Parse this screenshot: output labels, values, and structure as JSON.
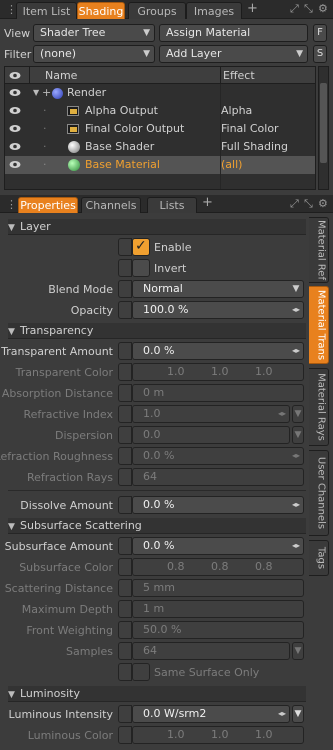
{
  "top_tabs": [
    "Item List",
    "Shading",
    "Groups",
    "Images"
  ],
  "top_active_tab": 1,
  "view": {
    "label": "View",
    "value": "Shader Tree",
    "assign": "Assign Material",
    "f_btn": "F"
  },
  "filter": {
    "label": "Filter",
    "value": "(none)",
    "add_layer": "Add Layer",
    "s_btn": "S"
  },
  "tree": {
    "col_name": "Name",
    "col_effect": "Effect",
    "rows": [
      {
        "name": "Render",
        "effect": ""
      },
      {
        "name": "Alpha Output",
        "effect": "Alpha"
      },
      {
        "name": "Final Color Output",
        "effect": "Final Color"
      },
      {
        "name": "Base Shader",
        "effect": "Full Shading"
      },
      {
        "name": "Base Material",
        "effect": "(all)"
      }
    ]
  },
  "prop_tabs": [
    "Properties",
    "Channels",
    "Lists"
  ],
  "side_tabs": [
    "Material Ref",
    "Material Trans",
    "Material Rays",
    "User Channels",
    "Tags"
  ],
  "sections": {
    "layer": "Layer",
    "transparency": "Transparency",
    "subsurface": "Subsurface Scattering",
    "luminosity": "Luminosity"
  },
  "layer": {
    "enable": "Enable",
    "invert": "Invert",
    "blend_label": "Blend Mode",
    "blend_value": "Normal",
    "opacity_label": "Opacity",
    "opacity_value": "100.0 %"
  },
  "transparency": {
    "amount_label": "Transparent Amount",
    "amount_value": "0.0 %",
    "color_label": "Transparent Color",
    "color_r": "1.0",
    "color_g": "1.0",
    "color_b": "1.0",
    "absorption_label": "Absorption Distance",
    "absorption_value": "0 m",
    "refr_index_label": "Refractive Index",
    "refr_index_value": "1.0",
    "dispersion_label": "Dispersion",
    "dispersion_value": "0.0",
    "refr_rough_label": "Refraction Roughness",
    "refr_rough_value": "0.0 %",
    "refr_rays_label": "Refraction Rays",
    "refr_rays_value": "64",
    "dissolve_label": "Dissolve Amount",
    "dissolve_value": "0.0 %"
  },
  "subsurface": {
    "amount_label": "Subsurface Amount",
    "amount_value": "0.0 %",
    "color_label": "Subsurface Color",
    "color_r": "0.8",
    "color_g": "0.8",
    "color_b": "0.8",
    "scatter_label": "Scattering Distance",
    "scatter_value": "5 mm",
    "depth_label": "Maximum Depth",
    "depth_value": "1 m",
    "front_label": "Front Weighting",
    "front_value": "50.0 %",
    "samples_label": "Samples",
    "samples_value": "64",
    "same_surface": "Same Surface Only"
  },
  "luminosity": {
    "intensity_label": "Luminous Intensity",
    "intensity_value": "0.0 W/srm2",
    "color_label": "Luminous Color",
    "color_r": "1.0",
    "color_g": "1.0",
    "color_b": "1.0"
  },
  "colors": {
    "accent": "#e8811e",
    "selected_text": "#f0a030"
  }
}
